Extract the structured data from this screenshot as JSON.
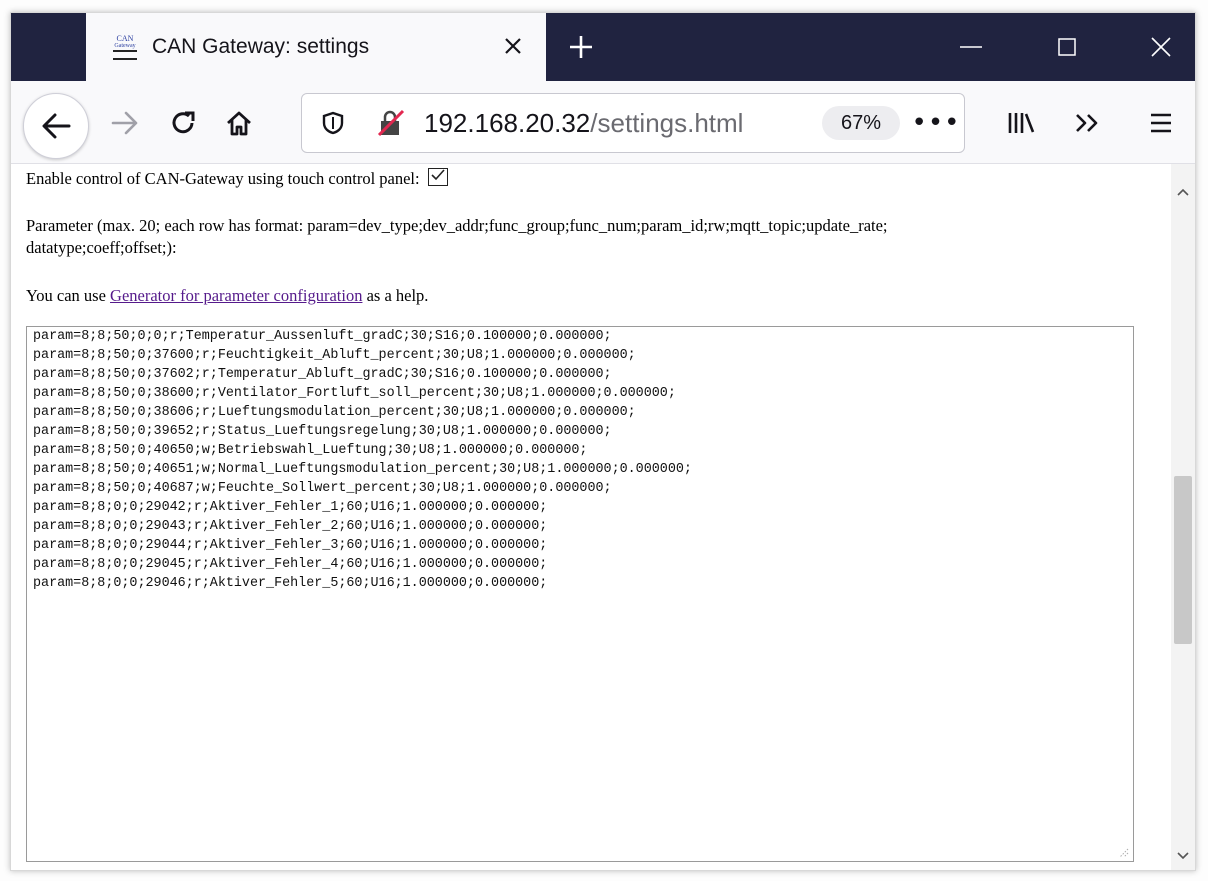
{
  "browser": {
    "tab_title": "CAN Gateway: settings",
    "favicon_text_top": "CAN",
    "favicon_text_bottom": "Gateway",
    "url_host": "192.168.20.32",
    "url_path": "/settings.html",
    "zoom": "67%",
    "colors": {
      "titlebar": "#202340",
      "tab": "#f9f9fb",
      "link": "#551a8b"
    },
    "icons": [
      "tab-favicon",
      "close-icon",
      "plus-icon",
      "minimize-icon",
      "maximize-icon",
      "window-close-icon",
      "back-arrow-icon",
      "forward-arrow-icon",
      "reload-icon",
      "home-icon",
      "shield-icon",
      "insecure-lock-icon",
      "more-dots-icon",
      "library-icon",
      "overflow-chevrons-icon",
      "hamburger-menu-icon"
    ]
  },
  "page": {
    "enable_label": "Enable control of CAN-Gateway using touch control panel:",
    "enable_checked": true,
    "parameter_line1": "Parameter (max. 20; each row has format: param=dev_type;dev_addr;func_group;func_num;param_id;rw;mqtt_topic;update_rate;",
    "parameter_line2": "datatype;coeff;offset;):",
    "help_prefix": "You can use ",
    "help_link": "Generator for parameter configuration",
    "help_suffix": " as a help.",
    "params": [
      "param=8;8;50;0;0;r;Temperatur_Aussenluft_gradC;30;S16;0.100000;0.000000;",
      "param=8;8;50;0;37600;r;Feuchtigkeit_Abluft_percent;30;U8;1.000000;0.000000;",
      "param=8;8;50;0;37602;r;Temperatur_Abluft_gradC;30;S16;0.100000;0.000000;",
      "param=8;8;50;0;38600;r;Ventilator_Fortluft_soll_percent;30;U8;1.000000;0.000000;",
      "param=8;8;50;0;38606;r;Lueftungsmodulation_percent;30;U8;1.000000;0.000000;",
      "param=8;8;50;0;39652;r;Status_Lueftungsregelung;30;U8;1.000000;0.000000;",
      "param=8;8;50;0;40650;w;Betriebswahl_Lueftung;30;U8;1.000000;0.000000;",
      "param=8;8;50;0;40651;w;Normal_Lueftungsmodulation_percent;30;U8;1.000000;0.000000;",
      "param=8;8;50;0;40687;w;Feuchte_Sollwert_percent;30;U8;1.000000;0.000000;",
      "param=8;8;0;0;29042;r;Aktiver_Fehler_1;60;U16;1.000000;0.000000;",
      "param=8;8;0;0;29043;r;Aktiver_Fehler_2;60;U16;1.000000;0.000000;",
      "param=8;8;0;0;29044;r;Aktiver_Fehler_3;60;U16;1.000000;0.000000;",
      "param=8;8;0;0;29045;r;Aktiver_Fehler_4;60;U16;1.000000;0.000000;",
      "param=8;8;0;0;29046;r;Aktiver_Fehler_5;60;U16;1.000000;0.000000;"
    ]
  }
}
